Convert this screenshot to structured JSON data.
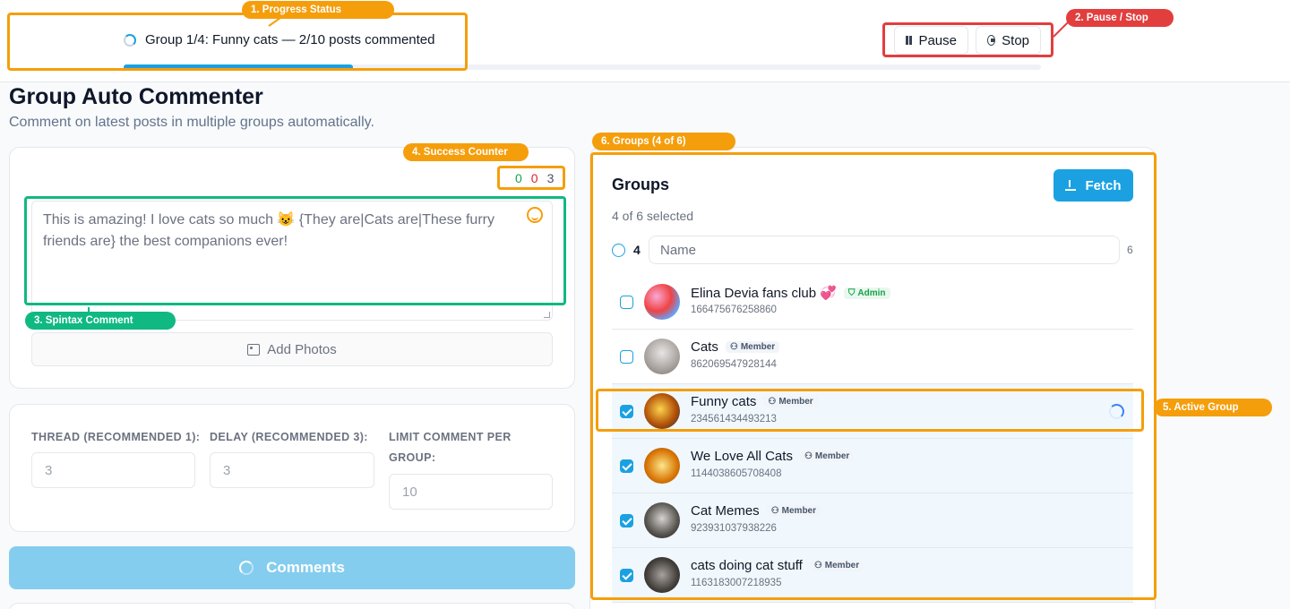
{
  "status": {
    "text": "Group 1/4: Funny cats — 2/10 posts commented",
    "progress_percent": 25,
    "pause_label": "Pause",
    "stop_label": "Stop"
  },
  "page": {
    "title": "Group Auto Commenter",
    "subtitle": "Comment on latest posts in multiple groups automatically."
  },
  "counter": {
    "success": "0",
    "failed": "0",
    "total": "3",
    "success_color": "#16a34a",
    "failed_color": "#dc2626",
    "total_color": "#4b5563"
  },
  "comment": {
    "text": "This is amazing! I love cats so much 😺 {They are|Cats are|These furry friends are} the best companions ever!",
    "add_photos_label": "Add Photos"
  },
  "settings": {
    "thread_label": "THREAD (RECOMMENDED 1):",
    "thread_value": "3",
    "delay_label": "DELAY (RECOMMENDED 3):",
    "delay_value": "3",
    "limit_label": "LIMIT COMMENT PER GROUP:",
    "limit_value": "10"
  },
  "comments_button_label": "Comments",
  "groups": {
    "title": "Groups",
    "selected_text": "4 of 6 selected",
    "fetch_label": "Fetch",
    "selected_count": "4",
    "total_count": "6",
    "search_placeholder": "Name",
    "items": [
      {
        "name": "Elina Devia fans club",
        "emoji": "💞",
        "role": "Admin",
        "id": "166475676258860",
        "checked": false,
        "active": false
      },
      {
        "name": "Cats",
        "emoji": "",
        "role": "Member",
        "id": "862069547928144",
        "checked": false,
        "active": false
      },
      {
        "name": "Funny cats",
        "emoji": "",
        "role": "Member",
        "id": "234561434493213",
        "checked": true,
        "active": true
      },
      {
        "name": "We Love All Cats",
        "emoji": "",
        "role": "Member",
        "id": "1144038605708408",
        "checked": true,
        "active": false
      },
      {
        "name": "Cat Memes",
        "emoji": "",
        "role": "Member",
        "id": "923931037938226",
        "checked": true,
        "active": false
      },
      {
        "name": "cats doing cat stuff",
        "emoji": "",
        "role": "Member",
        "id": "1163183007218935",
        "checked": true,
        "active": false
      }
    ]
  },
  "annotations": {
    "progress_status": "1. Progress Status",
    "pause_stop": "2. Pause / Stop",
    "spintax_comment": "3. Spintax Comment",
    "success_counter": "4. Success Counter",
    "active_group": "5. Active Group",
    "groups": "6. Groups (4 of 6)"
  },
  "colors": {
    "accent": "#1ba1e2",
    "annotation_orange": "#f59e0b",
    "annotation_red": "#e23e3e",
    "annotation_green": "#10b981"
  }
}
